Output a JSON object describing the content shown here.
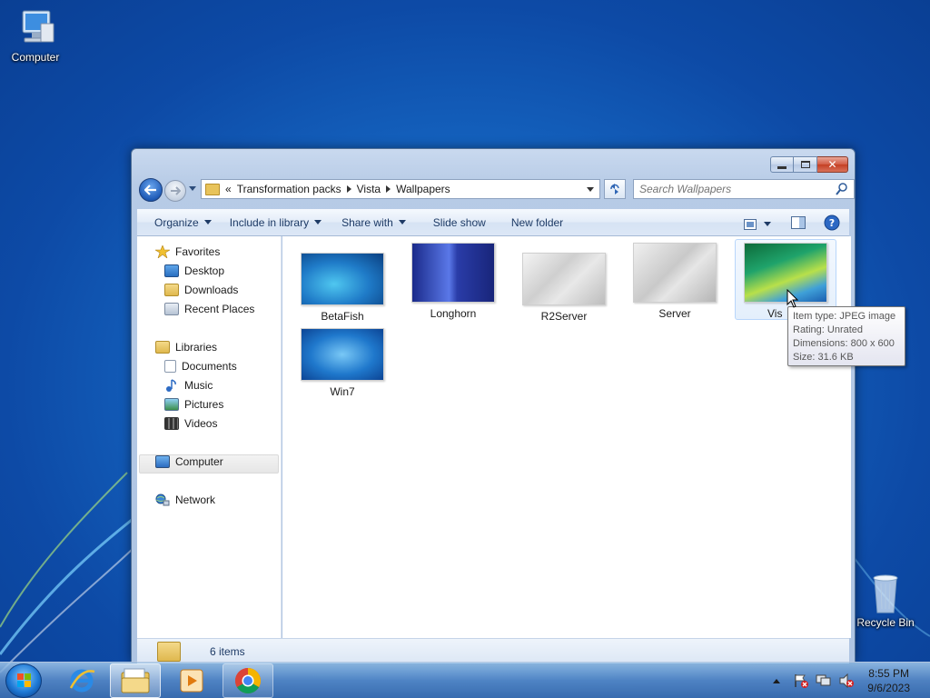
{
  "desktop": {
    "icons": [
      {
        "label": "Computer",
        "icon": "computer-icon"
      },
      {
        "label": "Recycle Bin",
        "icon": "recycle-bin-icon"
      }
    ]
  },
  "window": {
    "address": {
      "overflow": "«",
      "crumbs": [
        "Transformation packs",
        "Vista",
        "Wallpapers"
      ]
    },
    "search": {
      "placeholder": "Search Wallpapers"
    },
    "toolbar": {
      "organize": "Organize",
      "include_in_library": "Include in library",
      "share_with": "Share with",
      "slide_show": "Slide show",
      "new_folder": "New folder"
    },
    "nav": {
      "favorites": "Favorites",
      "desktop": "Desktop",
      "downloads": "Downloads",
      "recent_places": "Recent Places",
      "libraries": "Libraries",
      "documents": "Documents",
      "music": "Music",
      "pictures": "Pictures",
      "videos": "Videos",
      "computer": "Computer",
      "network": "Network"
    },
    "files": [
      {
        "name": "BetaFish"
      },
      {
        "name": "Longhorn"
      },
      {
        "name": "R2Server"
      },
      {
        "name": "Server"
      },
      {
        "name": "Vis"
      },
      {
        "name": "Win7"
      }
    ],
    "tooltip": {
      "line1": "Item type: JPEG image",
      "line2": "Rating: Unrated",
      "line3": "Dimensions: 800 x 600",
      "line4": "Size: 31.6 KB"
    },
    "status": {
      "count": "6 items"
    }
  },
  "taskbar": {
    "clock": {
      "time": "8:55 PM",
      "date": "9/6/2023"
    }
  }
}
